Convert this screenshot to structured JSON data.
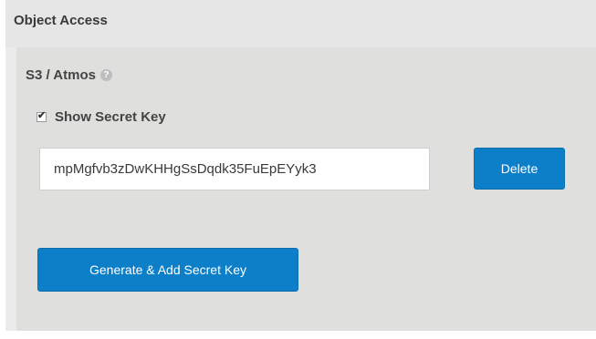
{
  "panel": {
    "title": "Object Access",
    "section_title": "S3 / Atmos",
    "help_icon": "question-circle-icon",
    "show_secret_key": {
      "label": "Show Secret Key",
      "checked": true
    },
    "secret_key": {
      "value": "mpMgfvb3zDwKHHgSsDqdk35FuEpEYyk3"
    },
    "delete_label": "Delete",
    "generate_label": "Generate & Add Secret Key",
    "accent_color": "#0c7fc8"
  }
}
